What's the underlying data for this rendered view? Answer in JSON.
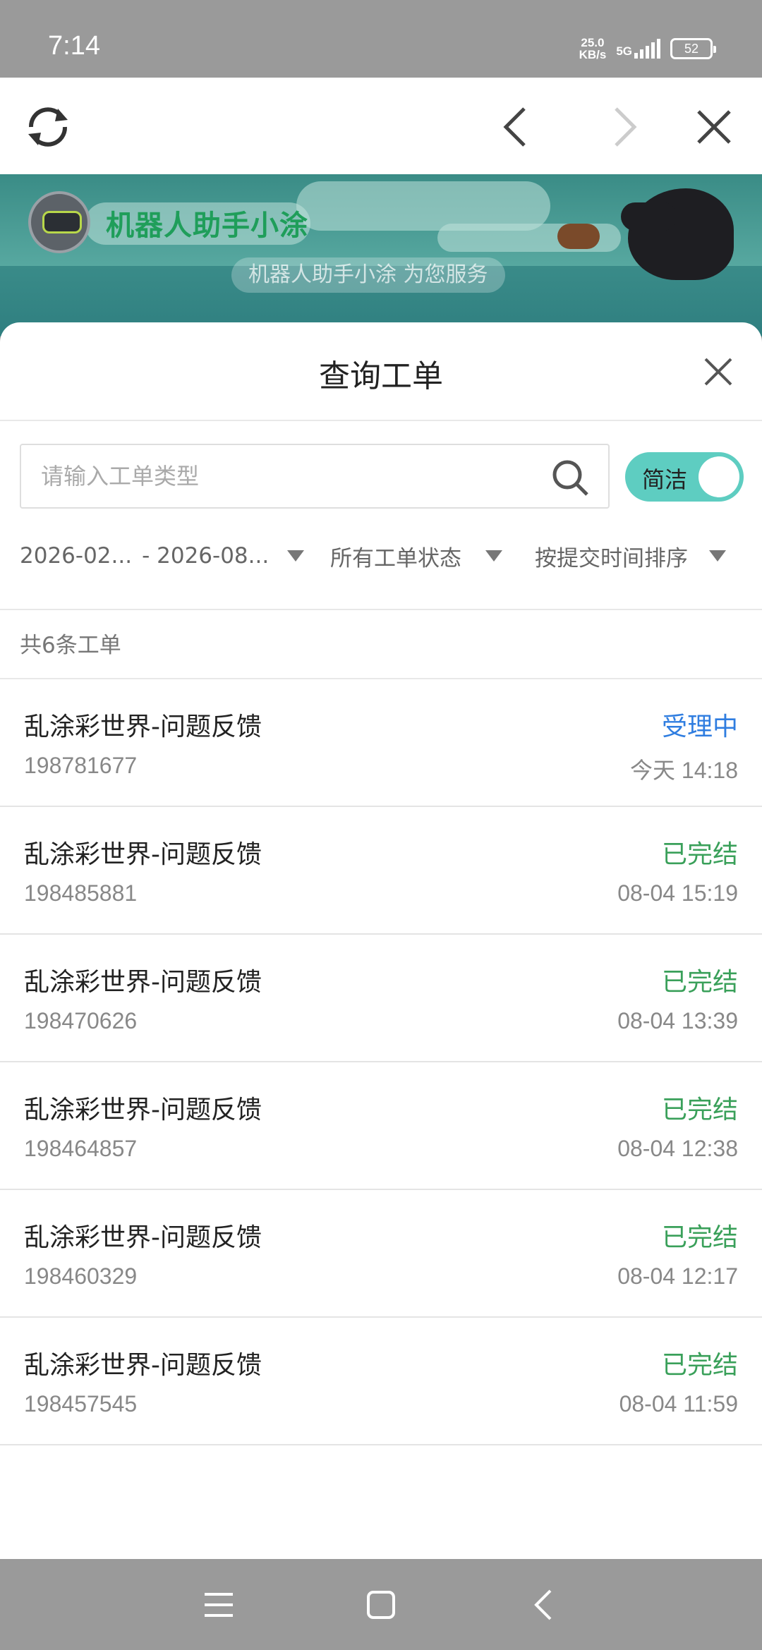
{
  "status_bar": {
    "time": "7:14",
    "net_speed_value": "25.0",
    "net_speed_unit": "KB/s",
    "network": "5G",
    "battery": "52"
  },
  "banner": {
    "title": "机器人助手小涂",
    "subtitle": "机器人助手小涂 为您服务"
  },
  "sheet": {
    "title": "查询工单",
    "search": {
      "placeholder": "请输入工单类型",
      "value": ""
    },
    "toggle_label": "简洁",
    "filters": {
      "date_start": "2026-02...",
      "date_end": "- 2026-08...",
      "status": "所有工单状态",
      "sort": "按提交时间排序"
    },
    "count_text": "共6条工单",
    "tickets": [
      {
        "title": "乱涂彩世界-问题反馈",
        "id": "198781677",
        "status": "受理中",
        "status_color": "#2f7de0",
        "time": "今天 14:18"
      },
      {
        "title": "乱涂彩世界-问题反馈",
        "id": "198485881",
        "status": "已完结",
        "status_color": "#3aa05a",
        "time": "08-04 15:19"
      },
      {
        "title": "乱涂彩世界-问题反馈",
        "id": "198470626",
        "status": "已完结",
        "status_color": "#3aa05a",
        "time": "08-04 13:39"
      },
      {
        "title": "乱涂彩世界-问题反馈",
        "id": "198464857",
        "status": "已完结",
        "status_color": "#3aa05a",
        "time": "08-04 12:38"
      },
      {
        "title": "乱涂彩世界-问题反馈",
        "id": "198460329",
        "status": "已完结",
        "status_color": "#3aa05a",
        "time": "08-04 12:17"
      },
      {
        "title": "乱涂彩世界-问题反馈",
        "id": "198457545",
        "status": "已完结",
        "status_color": "#3aa05a",
        "time": "08-04 11:59"
      }
    ]
  },
  "icons": {
    "toolbar": [
      "refresh-icon",
      "back-arrow-icon",
      "forward-arrow-icon",
      "close-icon"
    ],
    "nav": [
      "menu-icon",
      "home-square-icon",
      "back-triangle-icon"
    ]
  }
}
